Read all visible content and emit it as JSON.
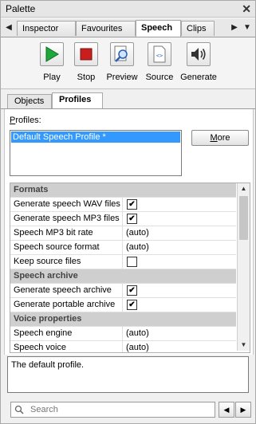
{
  "window": {
    "title": "Palette",
    "close_glyph": "✕"
  },
  "tabs": {
    "items": [
      {
        "label": "Inspector"
      },
      {
        "label": "Favourites"
      },
      {
        "label": "Speech",
        "active": true
      },
      {
        "label": "Clips"
      }
    ]
  },
  "toolbar": {
    "play_label": "Play",
    "stop_label": "Stop",
    "preview_label": "Preview",
    "source_label": "Source",
    "generate_label": "Generate"
  },
  "subtabs": {
    "objects_label": "Objects",
    "profiles_label": "Profiles"
  },
  "profiles": {
    "label": "Profiles:",
    "items": [
      "Default Speech Profile *"
    ],
    "more_label": "More"
  },
  "properties": {
    "sections": [
      {
        "title": "Formats",
        "rows": [
          {
            "key": "Generate speech WAV files",
            "type": "checkbox",
            "checked": true
          },
          {
            "key": "Generate speech MP3 files",
            "type": "checkbox",
            "checked": true
          },
          {
            "key": "Speech MP3 bit rate",
            "type": "text",
            "value": "(auto)"
          },
          {
            "key": "Speech source format",
            "type": "text",
            "value": "(auto)"
          },
          {
            "key": "Keep source files",
            "type": "checkbox",
            "checked": false
          }
        ]
      },
      {
        "title": "Speech archive",
        "rows": [
          {
            "key": "Generate speech archive",
            "type": "checkbox",
            "checked": true
          },
          {
            "key": "Generate portable archive",
            "type": "checkbox",
            "checked": true
          }
        ]
      },
      {
        "title": "Voice properties",
        "rows": [
          {
            "key": "Speech engine",
            "type": "text",
            "value": "(auto)"
          },
          {
            "key": "Speech voice",
            "type": "text",
            "value": "(auto)"
          }
        ]
      }
    ]
  },
  "description": "The default profile.",
  "search": {
    "placeholder": "Search"
  },
  "colors": {
    "selection": "#3399ff",
    "section_bg": "#cfcfcf",
    "play_green": "#1ea83a",
    "stop_red": "#c81e1e"
  }
}
